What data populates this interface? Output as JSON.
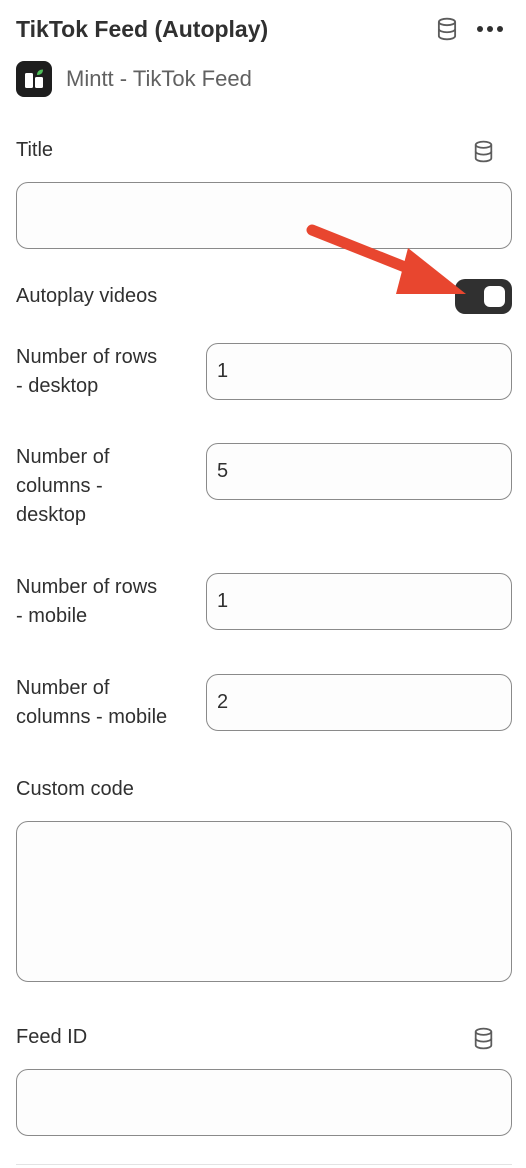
{
  "header": {
    "title": "TikTok Feed (Autoplay)",
    "app_name": "Mintt - TikTok Feed"
  },
  "fields": {
    "title": {
      "label": "Title",
      "value": ""
    },
    "autoplay": {
      "label": "Autoplay videos",
      "enabled": true
    },
    "rows_desktop": {
      "label_line1": "Number of rows",
      "label_line2": "- desktop",
      "value": "1"
    },
    "columns_desktop": {
      "label_line1": "Number of",
      "label_line2": "columns -",
      "label_line3": "desktop",
      "value": "5"
    },
    "rows_mobile": {
      "label_line1": "Number of rows",
      "label_line2": "- mobile",
      "value": "1"
    },
    "columns_mobile": {
      "label_line1": "Number of",
      "label_line2": "columns - mobile",
      "value": "2"
    },
    "custom_code": {
      "label": "Custom code",
      "value": ""
    },
    "feed_id": {
      "label": "Feed ID",
      "value": ""
    }
  },
  "colors": {
    "accent_arrow": "#e8462f",
    "toggle_on": "#303030",
    "logo_leaf": "#4fbf5a"
  },
  "icons": {
    "dynamic_source": "database-icon",
    "more": "ellipsis-icon",
    "app": "mintt-logo-icon"
  }
}
